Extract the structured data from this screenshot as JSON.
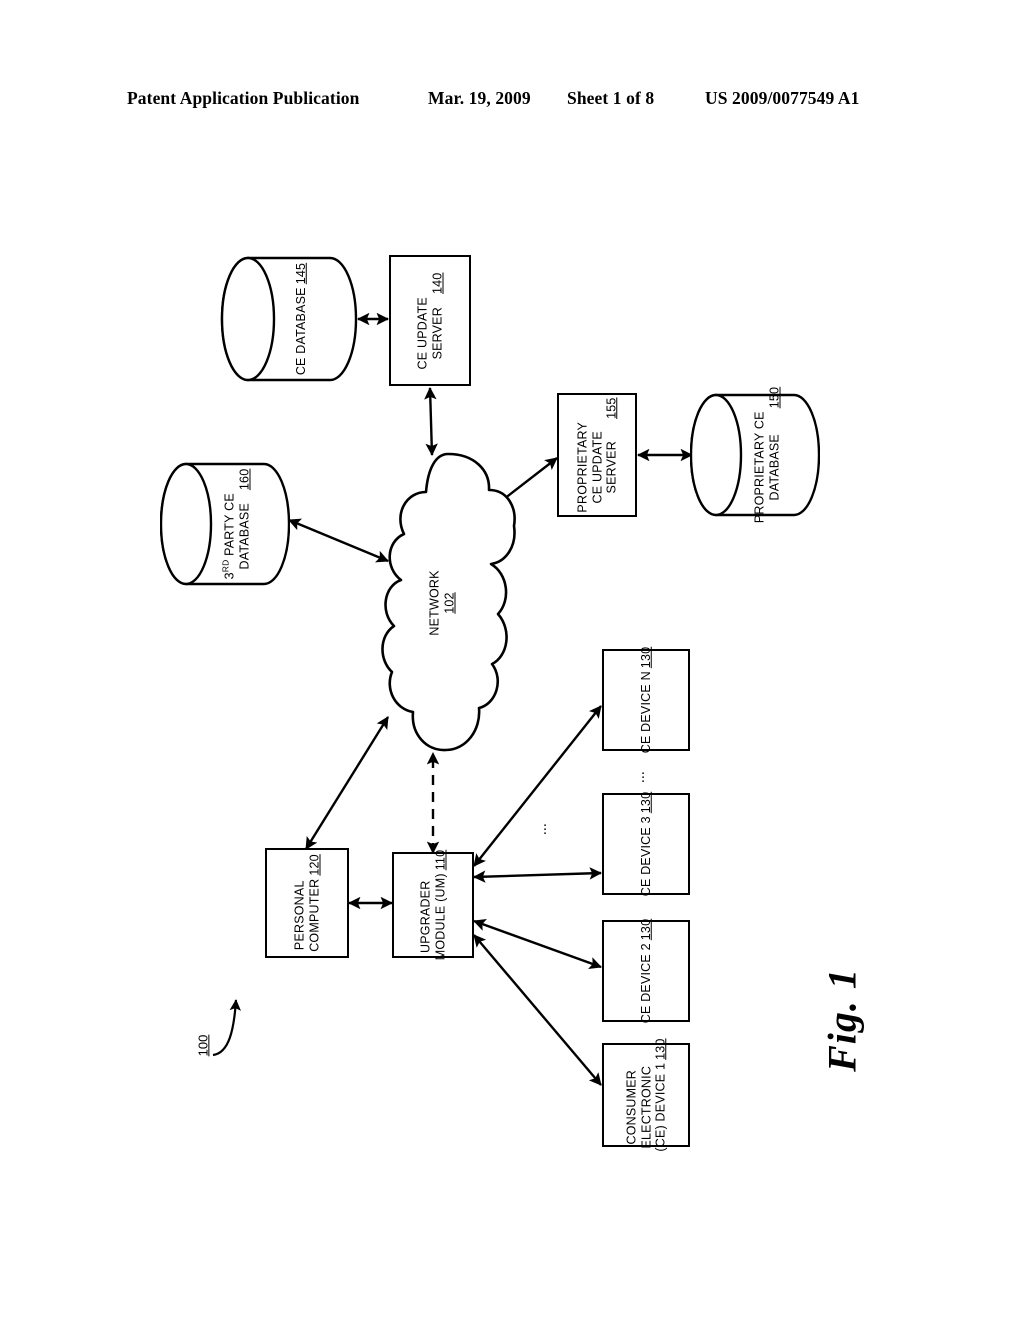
{
  "header": {
    "publication": "Patent Application Publication",
    "date": "Mar. 19, 2009",
    "sheet": "Sheet 1 of 8",
    "patent_number": "US 2009/0077549 A1"
  },
  "figure": {
    "caption": "Fig. 1",
    "system_ref": "100",
    "ellipsis": "⋮",
    "nodes": {
      "ce_database": {
        "label": "CE DATABASE",
        "ref": "145",
        "shape": "cylinder"
      },
      "ce_update_server": {
        "line1": "CE UPDATE",
        "line2": "SERVER",
        "ref": "140",
        "shape": "box"
      },
      "proprietary_ce_update_server": {
        "line1": "PROPRIETARY",
        "line2": "CE UPDATE",
        "line3": "SERVER",
        "ref": "155",
        "shape": "box"
      },
      "proprietary_ce_database": {
        "line1": "PROPRIETARY CE",
        "line2": "DATABASE",
        "ref": "150",
        "shape": "cylinder"
      },
      "third_party_ce_database": {
        "line1_pre": "3",
        "line1_sup": "RD",
        "line1_post": " PARTY CE",
        "line2": "DATABASE",
        "ref": "160",
        "shape": "cylinder"
      },
      "network": {
        "label": "NETWORK",
        "ref": "102",
        "shape": "cloud"
      },
      "personal_computer": {
        "line1": "PERSONAL",
        "line2": "COMPUTER",
        "ref": "120",
        "shape": "box"
      },
      "upgrader_module": {
        "line1": "UPGRADER",
        "line2": "MODULE (UM)",
        "ref": "110",
        "shape": "box"
      },
      "ce_device_n": {
        "label": "CE DEVICE N",
        "ref": "130",
        "shape": "box"
      },
      "ce_device_3": {
        "label": "CE DEVICE 3",
        "ref": "130",
        "shape": "box"
      },
      "ce_device_2": {
        "label": "CE DEVICE 2",
        "ref": "130",
        "shape": "box"
      },
      "ce_device_1": {
        "line1": "CONSUMER",
        "line2": "ELECTRONIC",
        "line3": "(CE) DEVICE 1",
        "ref": "130",
        "shape": "box"
      }
    },
    "connections": [
      {
        "from": "ce_database",
        "to": "ce_update_server",
        "style": "solid",
        "arrows": "both"
      },
      {
        "from": "ce_update_server",
        "to": "network",
        "style": "solid",
        "arrows": "both"
      },
      {
        "from": "network",
        "to": "proprietary_ce_update_server",
        "style": "solid",
        "arrows": "both"
      },
      {
        "from": "proprietary_ce_update_server",
        "to": "proprietary_ce_database",
        "style": "solid",
        "arrows": "both"
      },
      {
        "from": "third_party_ce_database",
        "to": "network",
        "style": "solid",
        "arrows": "both"
      },
      {
        "from": "personal_computer",
        "to": "network",
        "style": "solid",
        "arrows": "both"
      },
      {
        "from": "upgrader_module",
        "to": "network",
        "style": "dashed",
        "arrows": "both"
      },
      {
        "from": "personal_computer",
        "to": "upgrader_module",
        "style": "solid",
        "arrows": "both"
      },
      {
        "from": "upgrader_module",
        "to": "ce_device_n",
        "style": "solid",
        "arrows": "both"
      },
      {
        "from": "upgrader_module",
        "to": "ce_device_3",
        "style": "solid",
        "arrows": "both"
      },
      {
        "from": "upgrader_module",
        "to": "ce_device_2",
        "style": "solid",
        "arrows": "both"
      },
      {
        "from": "upgrader_module",
        "to": "ce_device_1",
        "style": "solid",
        "arrows": "both"
      }
    ]
  },
  "colors": {
    "ink": "#000000",
    "paper": "#ffffff"
  }
}
